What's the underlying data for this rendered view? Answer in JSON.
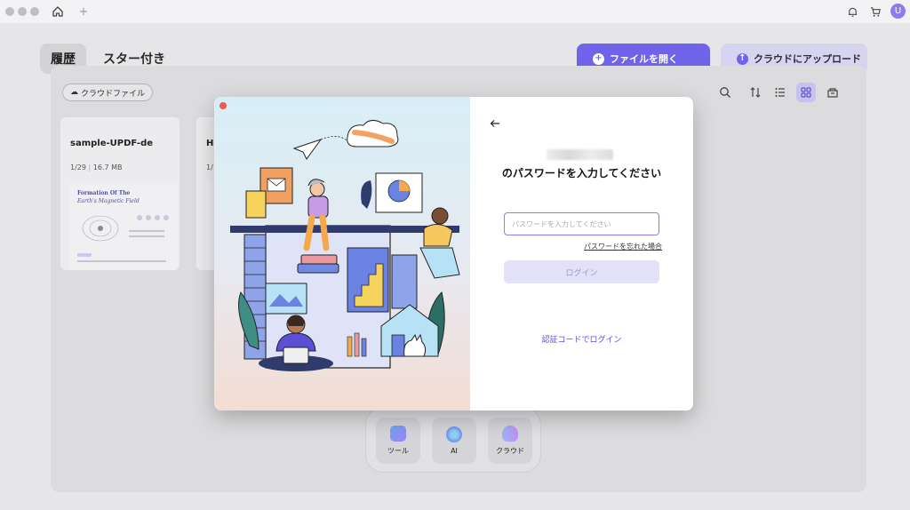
{
  "titlebar": {
    "home_icon": "home-icon",
    "new_tab": "+",
    "avatar_initial": "U"
  },
  "tabs": [
    {
      "label": "履歴",
      "active": true
    },
    {
      "label": "スター付き",
      "active": false
    }
  ],
  "actions": {
    "open_file": "ファイルを開く",
    "cloud_upload": "クラウドにアップロード"
  },
  "filter": {
    "cloud_files": "クラウドファイル"
  },
  "files": [
    {
      "name": "sample-UPDF-de",
      "date": "1/29",
      "size": "16.7 MB",
      "thumb_title": "Formation Of The",
      "thumb_subtitle": "Earth's Magnetic Field"
    },
    {
      "name": "Ha",
      "date": "1/",
      "size": ""
    }
  ],
  "dock": {
    "tools": "ツール",
    "ai": "AI",
    "cloud": "クラウド"
  },
  "login": {
    "heading": "のパスワードを入力してください",
    "password_placeholder": "パスワードを入力してください",
    "forgot_password": "パスワードを忘れた場合",
    "login_button": "ログイン",
    "code_login": "認証コードでログイン"
  },
  "colors": {
    "accent": "#6f63ea",
    "accent_light": "#d7d4f0",
    "close": "#f0594e"
  }
}
